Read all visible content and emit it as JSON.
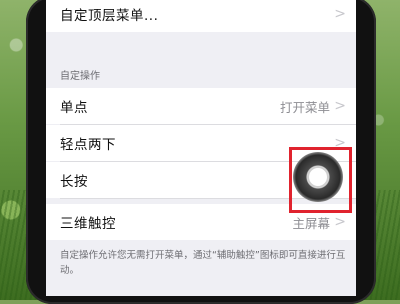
{
  "menu_row": {
    "label": "自定顶层菜单...",
    "chevron": ">"
  },
  "section_header": "自定操作",
  "rows": [
    {
      "label": "单点",
      "value": "打开菜单",
      "chevron": ">"
    },
    {
      "label": "轻点两下",
      "value": "",
      "chevron": ">"
    },
    {
      "label": "长按",
      "value": "",
      "chevron": ""
    },
    {
      "label": "三维触控",
      "value": "主屏幕",
      "chevron": ">"
    }
  ],
  "footer_text": "自定操作允许您无需打开菜单，通过“辅助触控”图标即可直接进行互动。",
  "colors": {
    "highlight": "#e0232e",
    "background_grass": "#5f8a3c"
  },
  "icons": {
    "assistive_touch": "assistive-touch-icon",
    "chevron": "chevron-right-icon"
  }
}
